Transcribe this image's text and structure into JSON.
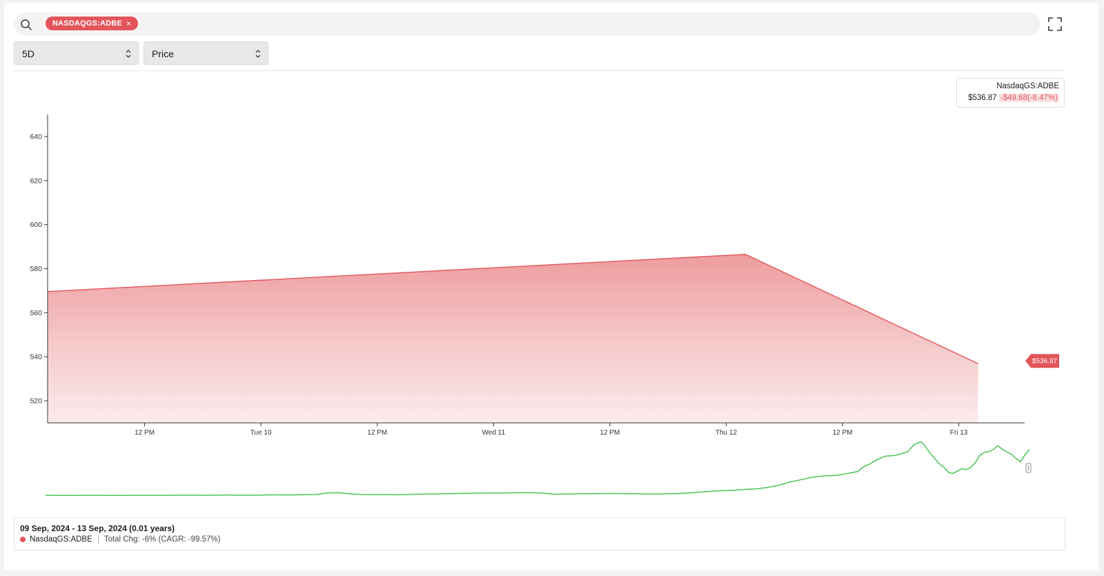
{
  "search": {
    "ticker_chip": "NASDAQGS:ADBE",
    "chip_close": "×"
  },
  "controls": {
    "range_select": "5D",
    "metric_select": "Price"
  },
  "legend": {
    "name": "NasdaqGS:ADBE",
    "price": "$536.87",
    "change": "-$49.68(-8.47%)"
  },
  "footer": {
    "range": "09 Sep, 2024 - 13 Sep, 2024 (0.01 years)",
    "series": "NasdaqGS:ADBE",
    "total_change": "Total Chg: -6% (CAGR: -99.57%)"
  },
  "colors": {
    "accent": "#e2555a",
    "area_top": "#ee9c9e",
    "navigator": "#4cc552"
  },
  "chart_data": {
    "type": "area",
    "x_ticks": [
      "12 PM",
      "Tue 10",
      "12 PM",
      "Wed 11",
      "12 PM",
      "Thu 12",
      "12 PM",
      "Fri 13"
    ],
    "x_domain": [
      0,
      4.2
    ],
    "x_tick_positions": [
      0.417,
      0.917,
      1.417,
      1.917,
      2.417,
      2.917,
      3.417,
      3.917
    ],
    "y_ticks": [
      520,
      540,
      560,
      600,
      620,
      640,
      580
    ],
    "ylim": [
      510,
      650
    ],
    "series": [
      {
        "points": [
          {
            "x": 0,
            "y": 569.6
          },
          {
            "x": 3.0,
            "y": 586.5
          },
          {
            "x": 4.0,
            "y": 536.87
          }
        ]
      }
    ],
    "last_value_label": "$536.87",
    "navigator_points": [
      [
        0,
        718
      ],
      [
        0.1,
        718.3
      ],
      [
        0.2,
        718
      ],
      [
        0.3,
        718.2
      ],
      [
        0.4,
        718
      ],
      [
        0.5,
        718.1
      ],
      [
        0.6,
        717.8
      ],
      [
        0.7,
        717.9
      ],
      [
        0.8,
        717.6
      ],
      [
        0.9,
        717.9
      ],
      [
        1.0,
        717.4
      ],
      [
        1.1,
        717.5
      ],
      [
        1.2,
        716.8
      ],
      [
        1.25,
        714.6
      ],
      [
        1.3,
        714.2
      ],
      [
        1.35,
        716
      ],
      [
        1.4,
        716.8
      ],
      [
        1.5,
        717
      ],
      [
        1.55,
        717.3
      ],
      [
        1.65,
        716.4
      ],
      [
        1.75,
        716
      ],
      [
        1.85,
        715.2
      ],
      [
        1.95,
        714.8
      ],
      [
        2.05,
        714.5
      ],
      [
        2.15,
        714.2
      ],
      [
        2.2,
        714.8
      ],
      [
        2.25,
        716.5
      ],
      [
        2.3,
        716.2
      ],
      [
        2.4,
        715.7
      ],
      [
        2.5,
        715.5
      ],
      [
        2.6,
        715.8
      ],
      [
        2.7,
        716.2
      ],
      [
        2.8,
        715.6
      ],
      [
        2.85,
        714.6
      ],
      [
        2.9,
        713.4
      ],
      [
        2.95,
        712.3
      ],
      [
        3.0,
        711.2
      ],
      [
        3.05,
        710.6
      ],
      [
        3.1,
        709.4
      ],
      [
        3.15,
        708.8
      ],
      [
        3.2,
        706.6
      ],
      [
        3.25,
        703.4
      ],
      [
        3.3,
        698.6
      ],
      [
        3.35,
        695.2
      ],
      [
        3.4,
        691.6
      ],
      [
        3.45,
        689.9
      ],
      [
        3.5,
        689.2
      ],
      [
        3.55,
        686.6
      ],
      [
        3.6,
        683.4
      ],
      [
        3.62,
        677.4
      ],
      [
        3.65,
        673.2
      ],
      [
        3.68,
        667.1
      ],
      [
        3.72,
        661.4
      ],
      [
        3.76,
        660.4
      ],
      [
        3.79,
        658.1
      ],
      [
        3.82,
        654.6
      ],
      [
        3.85,
        644.2
      ],
      [
        3.88,
        640.4
      ],
      [
        3.9,
        647.6
      ],
      [
        3.92,
        657.2
      ],
      [
        3.94,
        664.6
      ],
      [
        3.96,
        672.1
      ],
      [
        3.98,
        677.2
      ],
      [
        4.0,
        684.5
      ],
      [
        4.02,
        686.4
      ],
      [
        4.04,
        683.1
      ],
      [
        4.06,
        679.3
      ],
      [
        4.08,
        680.8
      ],
      [
        4.1,
        677.6
      ],
      [
        4.12,
        670.5
      ],
      [
        4.14,
        660.1
      ],
      [
        4.16,
        655.8
      ],
      [
        4.18,
        654.8
      ],
      [
        4.2,
        651.5
      ],
      [
        4.22,
        646.2
      ],
      [
        4.24,
        651.4
      ],
      [
        4.26,
        655.1
      ],
      [
        4.28,
        658.6
      ],
      [
        4.3,
        664.5
      ],
      [
        4.32,
        669.4
      ],
      [
        4.34,
        659.2
      ],
      [
        4.36,
        651.7
      ]
    ],
    "grid": false
  }
}
